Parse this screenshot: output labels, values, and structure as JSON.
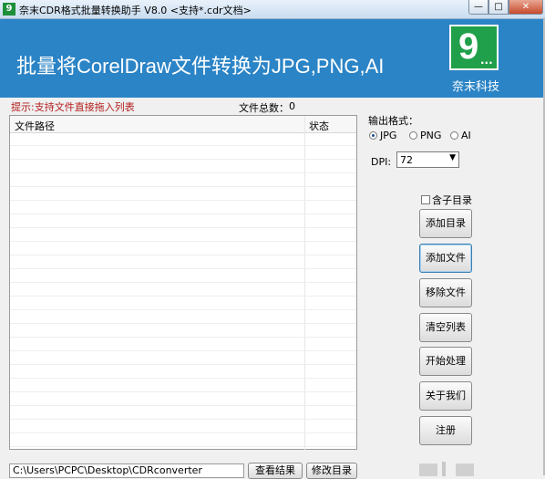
{
  "window": {
    "icon_glyph": "9",
    "title": "奈末CDR格式批量转换助手 V8.0    <支持*.cdr文档>",
    "min_glyph": "—",
    "max_glyph": "□",
    "close_glyph": "✕"
  },
  "banner": {
    "title": "批量将CorelDraw文件转换为JPG,PNG,AI",
    "logo_text": "9",
    "logo_dots": "...",
    "company": "奈末科技",
    "bg_color": "#2b84c6",
    "logo_color": "#20a04a"
  },
  "hint": "提示:支持文件直接拖入列表",
  "file_count": {
    "label": "文件总数：",
    "value": "0"
  },
  "list": {
    "columns": [
      "文件路径",
      "状态"
    ]
  },
  "output": {
    "label": "输出格式：",
    "options": [
      "JPG",
      "PNG",
      "AI"
    ],
    "selected": "JPG"
  },
  "dpi": {
    "label": "DPI:",
    "value": "72",
    "arrow": "▼"
  },
  "subfolder": {
    "label": "含子目录",
    "checked": false
  },
  "buttons": {
    "add_folder": "添加目录",
    "add_file": "添加文件",
    "remove_file": "移除文件",
    "clear_list": "清空列表",
    "start": "开始处理",
    "about": "关于我们",
    "register": "注册"
  },
  "footer": {
    "output_path": "C:\\Users\\PCPC\\Desktop\\CDRconverter",
    "view_result": "查看结果",
    "change_dir": "修改目录"
  }
}
